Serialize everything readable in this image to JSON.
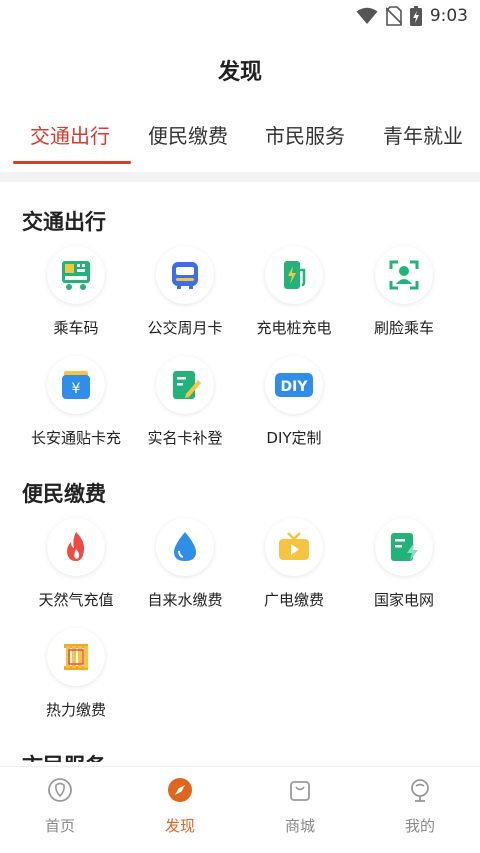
{
  "status_bar": {
    "time": "9:03"
  },
  "header": {
    "title": "发现"
  },
  "tabs": [
    {
      "label": "交通出行",
      "active": true
    },
    {
      "label": "便民缴费"
    },
    {
      "label": "市民服务"
    },
    {
      "label": "青年就业"
    }
  ],
  "sections": {
    "traffic": {
      "title": "交通出行",
      "items": [
        {
          "label": "乘车码",
          "icon": "bus-qr-icon"
        },
        {
          "label": "公交周月卡",
          "icon": "bus-card-icon"
        },
        {
          "label": "充电桩充电",
          "icon": "charging-pile-icon"
        },
        {
          "label": "刷脸乘车",
          "icon": "face-scan-icon"
        },
        {
          "label": "长安通贴卡充",
          "icon": "wallet-yuan-icon"
        },
        {
          "label": "实名卡补登",
          "icon": "edit-card-icon"
        },
        {
          "label": "DIY定制",
          "icon": "diy-icon"
        }
      ]
    },
    "payment": {
      "title": "便民缴费",
      "items": [
        {
          "label": "天然气充值",
          "icon": "flame-icon"
        },
        {
          "label": "自来水缴费",
          "icon": "water-drop-icon"
        },
        {
          "label": "广电缴费",
          "icon": "tv-icon"
        },
        {
          "label": "国家电网",
          "icon": "power-grid-icon"
        },
        {
          "label": "热力缴费",
          "icon": "radiator-icon"
        }
      ]
    },
    "citizen": {
      "title": "市民服务"
    }
  },
  "diy_icon_text": "DIY",
  "yuan_symbol": "¥",
  "bottom_nav": [
    {
      "label": "首页",
      "icon": "home-icon"
    },
    {
      "label": "发现",
      "icon": "compass-icon",
      "active": true
    },
    {
      "label": "商城",
      "icon": "shopping-bag-icon"
    },
    {
      "label": "我的",
      "icon": "profile-icon"
    }
  ],
  "colors": {
    "accent": "#d83a2c",
    "nav_active": "#e0651f"
  }
}
